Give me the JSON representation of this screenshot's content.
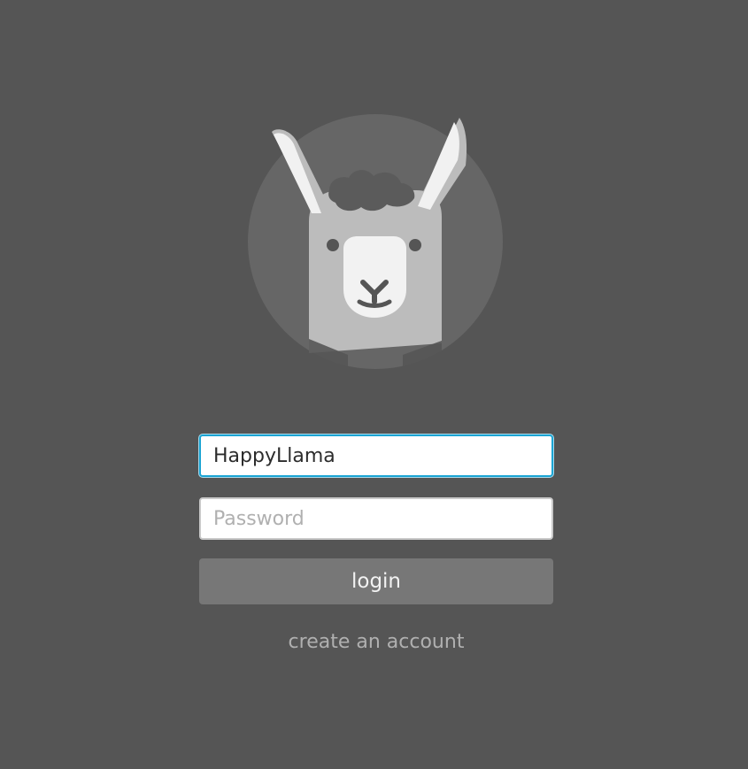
{
  "app": {
    "logo_icon": "llama-icon"
  },
  "login_form": {
    "username": {
      "value": "HappyLlama",
      "placeholder": ""
    },
    "password": {
      "value": "",
      "placeholder": "Password"
    },
    "login_label": "login",
    "create_account_label": "create an account"
  },
  "colors": {
    "background": "#555555",
    "logo_circle": "#666666",
    "llama_body": "#bcbcbc",
    "llama_ear_highlight": "#f1f1f1",
    "llama_face": "#f2f2f2",
    "accent_focus": "#1ba4d3",
    "button": "#777777",
    "muted_text": "#b0b0b0"
  }
}
